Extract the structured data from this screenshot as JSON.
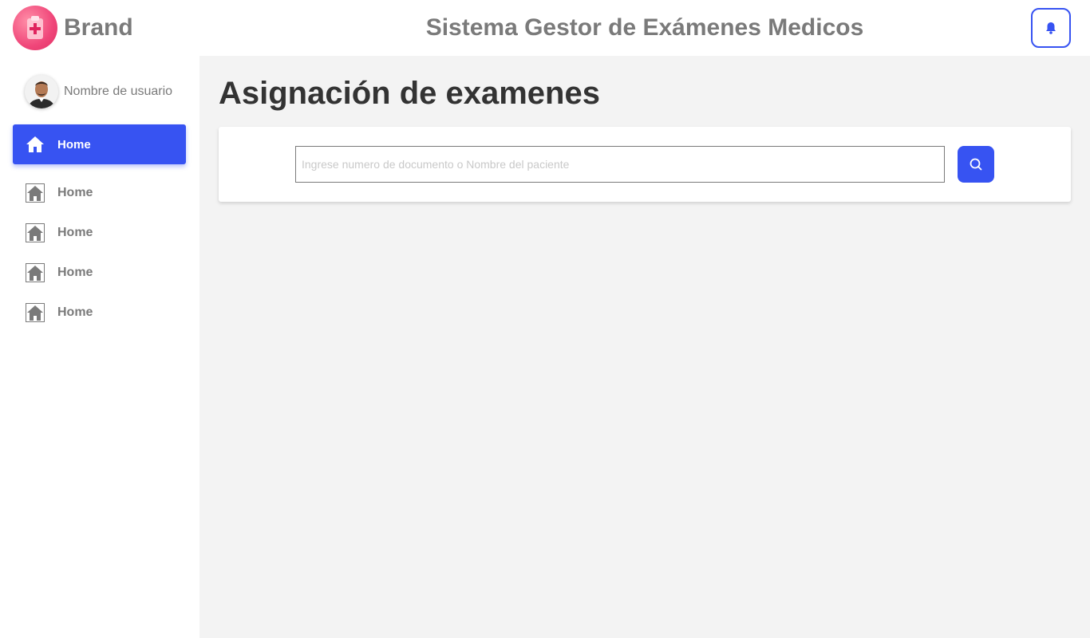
{
  "header": {
    "brand": "Brand",
    "title": "Sistema Gestor de Exámenes Medicos"
  },
  "icons": {
    "logo": "clipboard-medical-icon",
    "notifications": "bell-icon",
    "nav": "home-icon",
    "search": "search-icon"
  },
  "sidebar": {
    "user_name": "Nombre de usuario",
    "items": [
      {
        "label": "Home",
        "active": true
      },
      {
        "label": "Home",
        "active": false
      },
      {
        "label": "Home",
        "active": false
      },
      {
        "label": "Home",
        "active": false
      },
      {
        "label": "Home",
        "active": false
      }
    ]
  },
  "main": {
    "title": "Asignación de examenes",
    "search": {
      "placeholder": "Ingrese numero de documento o Nombre del paciente",
      "value": ""
    }
  },
  "colors": {
    "accent": "#3753f2",
    "brand": "#f0477a",
    "background": "#f3f3f3",
    "muted_text": "#7a7a7a"
  }
}
